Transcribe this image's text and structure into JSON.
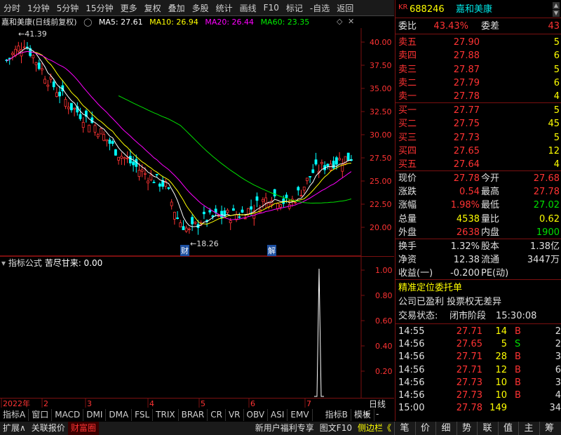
{
  "toolbar": {
    "items": [
      "分时",
      "1分钟",
      "5分钟",
      "15分钟",
      "更多",
      "复权",
      "叠加",
      "多股",
      "统计",
      "画线",
      "F10",
      "标记",
      "-自选",
      "返回"
    ]
  },
  "chart_info": {
    "title": "嘉和美康(日线前复权)",
    "ma5": "MA5: 27.61",
    "ma10": "MA10: 26.94",
    "ma20": "MA20: 26.44",
    "ma60": "MA60: 23.35",
    "high_mark": "41.39",
    "low_mark": "18.26",
    "tag1": "财",
    "tag2": "解"
  },
  "colors": {
    "ma5": "#ffffff",
    "ma10": "#ffff00",
    "ma20": "#ff00ff",
    "ma60": "#00e000",
    "up": "#ff3333",
    "down": "#00ffff",
    "grid": "#7a1010"
  },
  "price_axis": [
    "40.00",
    "37.50",
    "35.00",
    "32.50",
    "30.00",
    "27.50",
    "25.00",
    "22.50",
    "20.00"
  ],
  "indicator": {
    "label": "指标公式",
    "name": "苦尽甘来: 0.00",
    "axis": [
      "1.00",
      "0.80",
      "0.60",
      "0.40",
      "0.20"
    ]
  },
  "date_axis": [
    "2022年",
    "2",
    "3",
    "4",
    "5",
    "6",
    "7"
  ],
  "period_label": "日线",
  "bottom_tabs": [
    "指标A",
    "窗口",
    "MACD",
    "DMI",
    "DMA",
    "FSL",
    "TRIX",
    "BRAR",
    "CR",
    "VR",
    "OBV",
    "ASI",
    "EMV",
    "指标B",
    "模板"
  ],
  "statusbar": {
    "left": [
      "扩展∧",
      "关联报价",
      "财富圈"
    ],
    "middle": [
      "新用户福利专享",
      "图文F10",
      "侧边栏《"
    ],
    "right_tools": [
      "笔",
      "价",
      "细",
      "势",
      "联",
      "值",
      "主",
      "筹"
    ]
  },
  "stock": {
    "market": "KR",
    "code": "688246",
    "name": "嘉和美康"
  },
  "order_book": {
    "weibi_label": "委比",
    "weibi": "43.43%",
    "weicha_label": "委差",
    "weicha": "43",
    "asks": [
      {
        "label": "卖五",
        "price": "27.90",
        "vol": "5"
      },
      {
        "label": "卖四",
        "price": "27.88",
        "vol": "6"
      },
      {
        "label": "卖三",
        "price": "27.87",
        "vol": "5"
      },
      {
        "label": "卖二",
        "price": "27.79",
        "vol": "6"
      },
      {
        "label": "卖一",
        "price": "27.78",
        "vol": "4"
      }
    ],
    "bids": [
      {
        "label": "买一",
        "price": "27.77",
        "vol": "5"
      },
      {
        "label": "买二",
        "price": "27.75",
        "vol": "45"
      },
      {
        "label": "买三",
        "price": "27.73",
        "vol": "5"
      },
      {
        "label": "买四",
        "price": "27.65",
        "vol": "12"
      },
      {
        "label": "买五",
        "price": "27.64",
        "vol": "4"
      }
    ]
  },
  "quote": [
    {
      "l1": "现价",
      "v1": "27.78",
      "l2": "今开",
      "v2": "27.68",
      "c1": "red",
      "c2": "red"
    },
    {
      "l1": "涨跌",
      "v1": "0.54",
      "l2": "最高",
      "v2": "27.78",
      "c1": "red",
      "c2": "red"
    },
    {
      "l1": "涨幅",
      "v1": "1.98%",
      "l2": "最低",
      "v2": "27.02",
      "c1": "red",
      "c2": "grn"
    },
    {
      "l1": "总量",
      "v1": "4538",
      "l2": "量比",
      "v2": "0.62",
      "c1": "yel",
      "c2": "yel"
    },
    {
      "l1": "外盘",
      "v1": "2638",
      "l2": "内盘",
      "v2": "1900",
      "c1": "red",
      "c2": "grn"
    }
  ],
  "quote2": [
    {
      "l1": "换手",
      "v1": "1.32%",
      "l2": "股本",
      "v2": "1.38亿"
    },
    {
      "l1": "净资",
      "v1": "12.38",
      "l2": "流通",
      "v2": "3447万"
    },
    {
      "l1": "收益(一)",
      "v1": "-0.200",
      "l2": "PE(动)",
      "v2": ""
    }
  ],
  "notes": {
    "title": "精准定位委托单",
    "line1": "公司已盈利 投票权无差异",
    "status_label": "交易状态:",
    "status_value": "闭市阶段",
    "status_time": "15:30:08"
  },
  "ticks": [
    {
      "t": "14:55",
      "p": "27.71",
      "v": "14",
      "s": "B",
      "n": "2"
    },
    {
      "t": "14:56",
      "p": "27.65",
      "v": "5",
      "s": "S",
      "n": "2"
    },
    {
      "t": "14:56",
      "p": "27.71",
      "v": "28",
      "s": "B",
      "n": "3"
    },
    {
      "t": "14:56",
      "p": "27.71",
      "v": "12",
      "s": "B",
      "n": "6"
    },
    {
      "t": "14:56",
      "p": "27.73",
      "v": "10",
      "s": "B",
      "n": "3"
    },
    {
      "t": "14:56",
      "p": "27.73",
      "v": "10",
      "s": "B",
      "n": "4"
    },
    {
      "t": "15:00",
      "p": "27.78",
      "v": "149",
      "s": "",
      "n": "34"
    }
  ]
}
